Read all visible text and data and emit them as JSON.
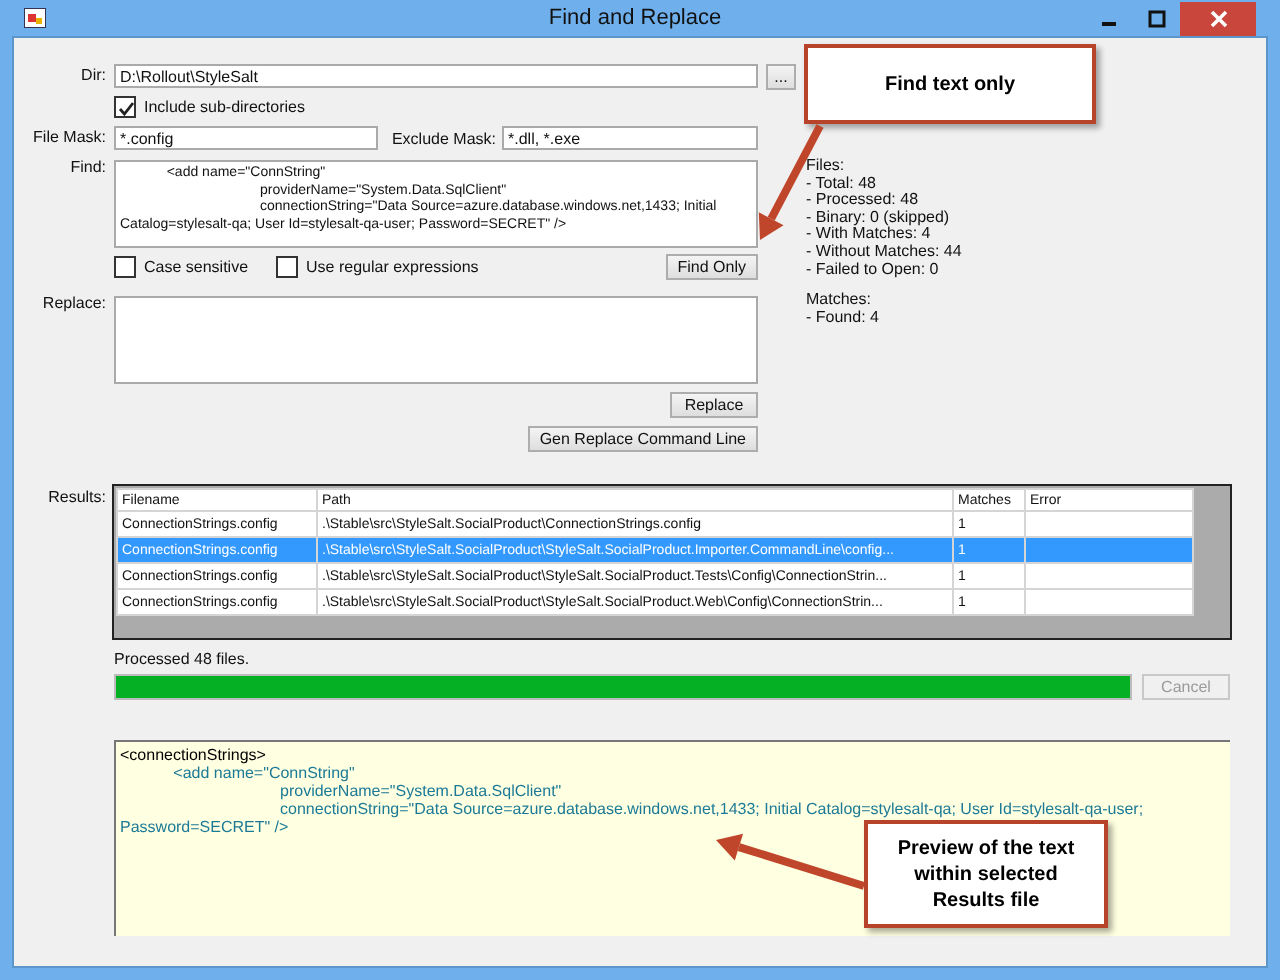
{
  "window": {
    "title": "Find and Replace"
  },
  "dir": {
    "label": "Dir:",
    "value": "D:\\Rollout\\StyleSalt",
    "browse_button": "..."
  },
  "include_subdirectories": {
    "label": "Include sub-directories",
    "checked": true
  },
  "file_mask": {
    "label": "File Mask:",
    "value": "*.config"
  },
  "exclude_mask": {
    "label": "Exclude Mask:",
    "value": "*.dll, *.exe"
  },
  "find": {
    "label": "Find:",
    "value": "\t<add name=\"ConnString\"\n\t\t\tproviderName=\"System.Data.SqlClient\"\n\t\t\tconnectionString=\"Data Source=azure.database.windows.net,1433; Initial Catalog=stylesalt-qa; User Id=stylesalt-qa-user; Password=SECRET\" />"
  },
  "options": [
    {
      "label": "Case sensitive",
      "checked": false
    },
    {
      "label": "Use regular expressions",
      "checked": false
    }
  ],
  "find_only_button": "Find Only",
  "replace": {
    "label": "Replace:"
  },
  "replace_button": "Replace",
  "gen_command_button": "Gen Replace Command Line",
  "stats": {
    "files_heading": "Files:",
    "files": [
      "- Total: 48",
      "- Processed: 48",
      "- Binary: 0 (skipped)",
      "- With Matches: 4",
      "- Without Matches: 44",
      "- Failed to Open: 0"
    ],
    "matches_heading": "Matches:",
    "matches": [
      "- Found: 4"
    ]
  },
  "results": {
    "label": "Results:",
    "columns": [
      "Filename",
      "Path",
      "Matches",
      "Error"
    ],
    "rows": [
      {
        "filename": "ConnectionStrings.config",
        "path": ".\\Stable\\src\\StyleSalt.SocialProduct\\ConnectionStrings.config",
        "matches": "1",
        "selected": false
      },
      {
        "filename": "ConnectionStrings.config",
        "path": ".\\Stable\\src\\StyleSalt.SocialProduct\\StyleSalt.SocialProduct.Importer.CommandLine\\config...",
        "matches": "1",
        "selected": true
      },
      {
        "filename": "ConnectionStrings.config",
        "path": ".\\Stable\\src\\StyleSalt.SocialProduct\\StyleSalt.SocialProduct.Tests\\Config\\ConnectionStrin...",
        "matches": "1",
        "selected": false
      },
      {
        "filename": "ConnectionStrings.config",
        "path": ".\\Stable\\src\\StyleSalt.SocialProduct\\StyleSalt.SocialProduct.Web\\Config\\ConnectionStrin...",
        "matches": "1",
        "selected": false
      }
    ]
  },
  "status": "Processed 48 files.",
  "progress": {
    "level": 1
  },
  "cancel_button": {
    "label": "Cancel",
    "disabled": true
  },
  "preview": {
    "lines": [
      {
        "text": "<connectionStrings>",
        "color": "#000000"
      },
      {
        "text": "\t<add name=\"ConnString\"\n\t\t\tproviderName=\"System.Data.SqlClient\"\n\t\t\tconnectionString=\"Data Source=azure.database.windows.net,1433; Initial Catalog=stylesalt-qa; User Id=stylesalt-qa-user; Password=SECRET\" />",
        "color": "#1c7a96"
      }
    ]
  },
  "callouts": [
    {
      "text": "Find text only"
    },
    {
      "text": "Preview of the text within selected Results file"
    }
  ]
}
